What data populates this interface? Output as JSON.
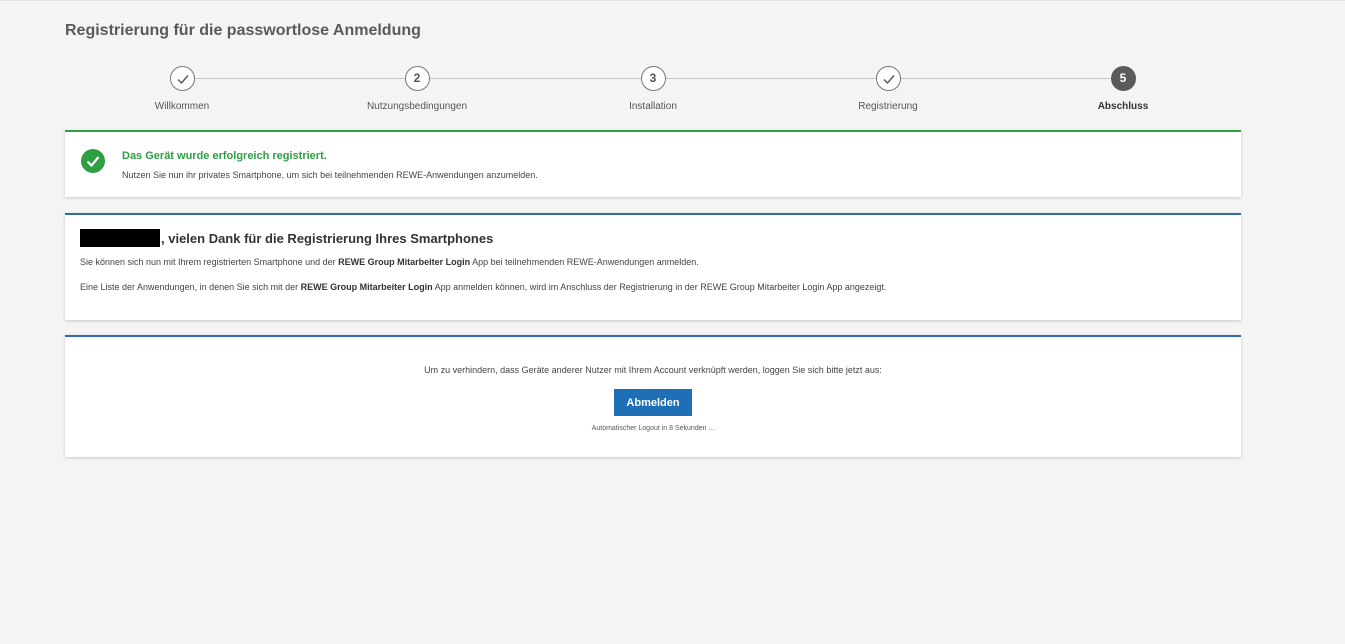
{
  "page": {
    "title": "Registrierung für die passwortlose Anmeldung"
  },
  "stepper": {
    "steps": [
      {
        "label": "Willkommen",
        "number": "",
        "state": "done"
      },
      {
        "label": "Nutzungsbedingungen",
        "number": "2",
        "state": "pending"
      },
      {
        "label": "Installation",
        "number": "3",
        "state": "pending"
      },
      {
        "label": "Registrierung",
        "number": "",
        "state": "done"
      },
      {
        "label": "Abschluss",
        "number": "5",
        "state": "active"
      }
    ]
  },
  "success": {
    "title": "Das Gerät wurde erfolgreich registriert.",
    "text": "Nutzen Sie nun ihr privates Smartphone, um sich bei teilnehmenden REWE-Anwendungen anzumelden."
  },
  "info": {
    "heading_suffix": ", vielen Dank für die Registrierung Ihres Smartphones",
    "p1_before": "Sie können sich nun mit Ihrem registrierten Smartphone und der ",
    "p1_bold": "REWE Group Mitarbeiter Login",
    "p1_after": " App bei teilnehmenden REWE-Anwendungen anmelden.",
    "p2_before": "Eine Liste der Anwendungen, in denen Sie sich mit der ",
    "p2_bold": "REWE Group Mitarbeiter Login",
    "p2_after": " App anmelden können, wird im Anschluss der Registrierung in der REWE Group Mitarbeiter Login App angezeigt."
  },
  "logout": {
    "text": "Um zu verhindern, dass Geräte anderer Nutzer mit Ihrem Account verknüpft werden, loggen Sie sich bitte jetzt aus:",
    "button_label": "Abmelden",
    "countdown": "Automatischer Logout in 8 Sekunden ..."
  },
  "colors": {
    "success": "#2ea043",
    "accent": "#2d6ca8",
    "button": "#1f6fb6"
  }
}
